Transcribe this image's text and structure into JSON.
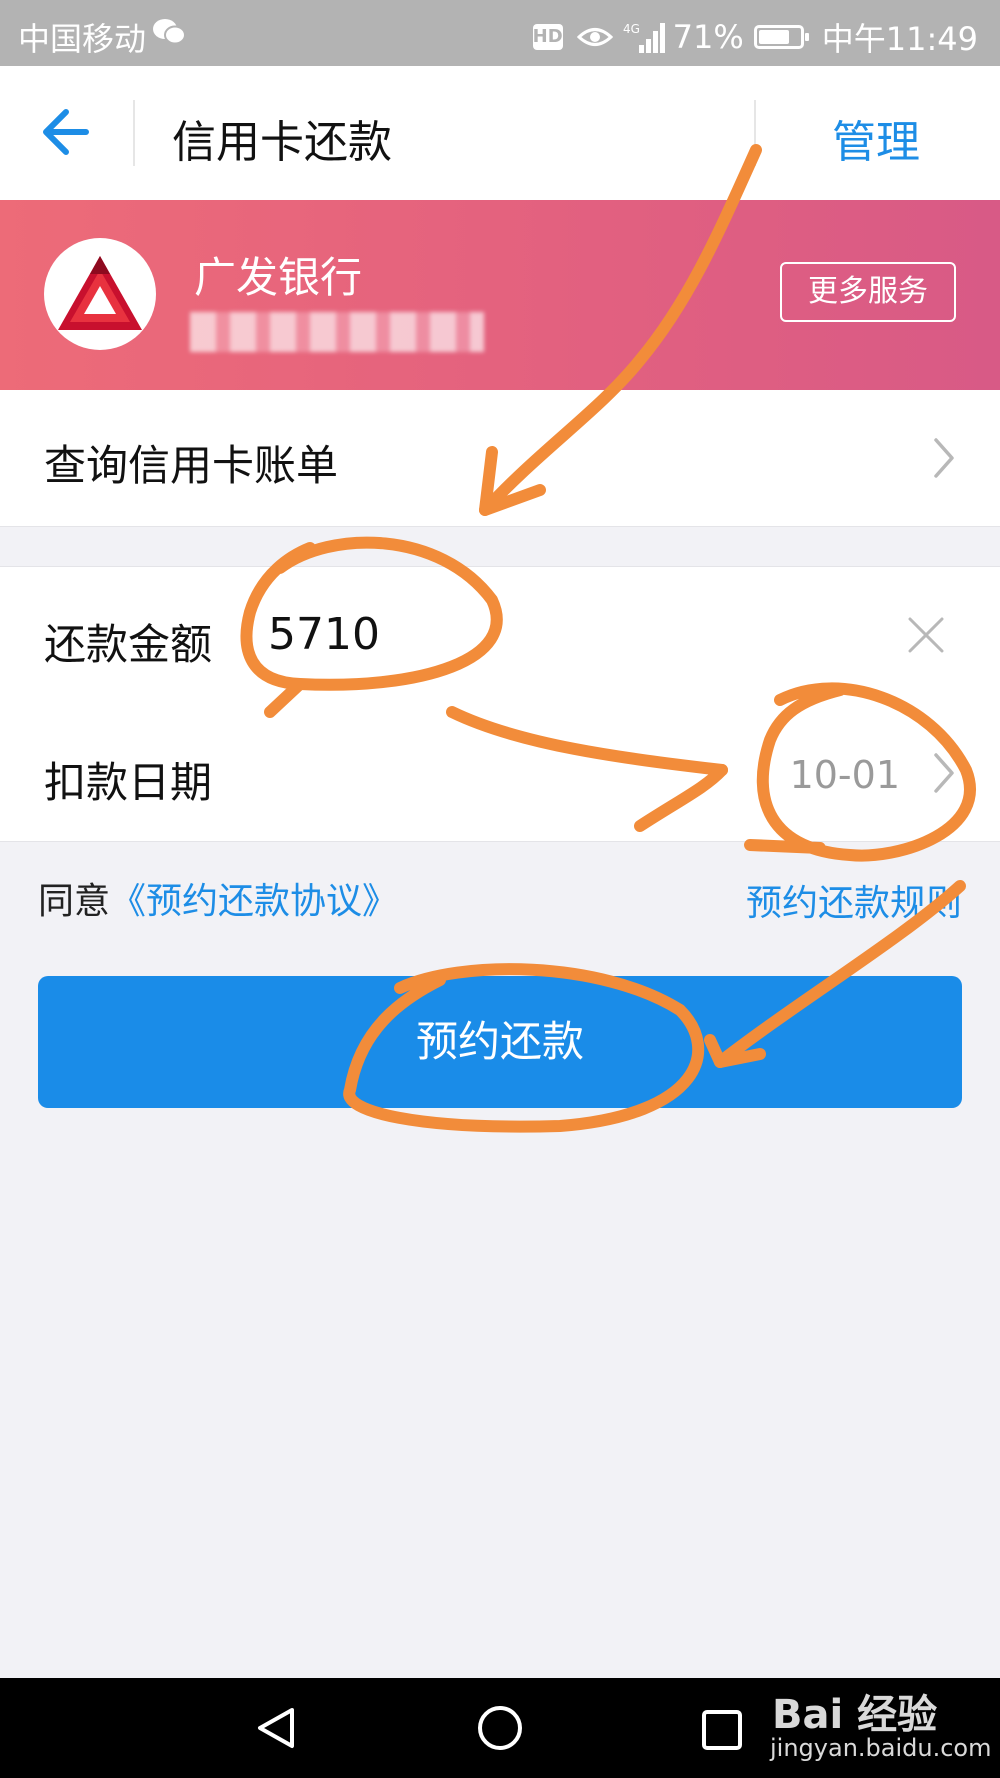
{
  "status_bar": {
    "carrier": "中国移动",
    "hd": "HD",
    "network": "4G",
    "battery": "71%",
    "time": "中午11:49"
  },
  "header": {
    "title": "信用卡还款",
    "manage_label": "管理"
  },
  "bank": {
    "name": "广发银行",
    "more_services_label": "更多服务"
  },
  "bill_row": {
    "label": "查询信用卡账单"
  },
  "amount_row": {
    "label": "还款金额",
    "value": "5710"
  },
  "date_row": {
    "label": "扣款日期",
    "value": "10-01"
  },
  "agreement": {
    "prefix": "同意",
    "link": "《预约还款协议》",
    "rules_link": "预约还款规则"
  },
  "submit": {
    "label": "预约还款"
  },
  "watermark": {
    "main": "Bai 经验",
    "sub": "jingyan.baidu.com"
  },
  "colors": {
    "accent": "#1a8ce8",
    "banner_start": "#ed6b78",
    "banner_end": "#d85a86",
    "annotation": "#f28c3a"
  }
}
